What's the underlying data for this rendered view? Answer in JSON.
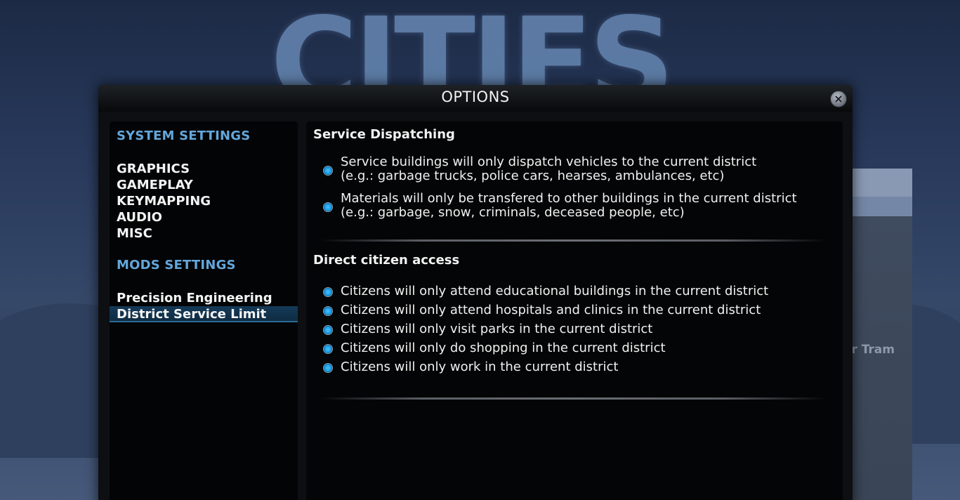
{
  "background": {
    "logo_text": "CITIES",
    "side_panel_text": "r Tram"
  },
  "window": {
    "title": "OPTIONS",
    "close_label": "×"
  },
  "nav": {
    "system_heading": "SYSTEM SETTINGS",
    "system_items": [
      "GRAPHICS",
      "GAMEPLAY",
      "KEYMAPPING",
      "AUDIO",
      "MISC"
    ],
    "mods_heading": "MODS SETTINGS",
    "mods_items": [
      "Precision Engineering",
      "District Service Limit"
    ],
    "selected": "District Service Limit"
  },
  "content": {
    "sections": [
      {
        "title": "Service Dispatching",
        "options": [
          {
            "line1": "Service buildings will only dispatch vehicles to the current district",
            "line2": "(e.g.: garbage trucks, police cars, hearses, ambulances, etc)",
            "checked": true
          },
          {
            "line1": "Materials will only be transfered to other buildings in the current district",
            "line2": "(e.g.: garbage, snow, criminals, deceased people, etc)",
            "checked": true
          }
        ]
      },
      {
        "title": "Direct citizen access",
        "options": [
          {
            "line1": "Citizens will only attend educational buildings in the current district",
            "checked": true
          },
          {
            "line1": "Citizens will only attend hospitals and clinics in the current district",
            "checked": true
          },
          {
            "line1": "Citizens will only visit parks in the current district",
            "checked": true
          },
          {
            "line1": "Citizens will only do shopping in the current district",
            "checked": true
          },
          {
            "line1": "Citizens will only work in the current district",
            "checked": true
          }
        ]
      }
    ]
  },
  "colors": {
    "accent": "#63a7db",
    "radio_on": "#1b9be0",
    "selected_bg": "#143a58"
  }
}
